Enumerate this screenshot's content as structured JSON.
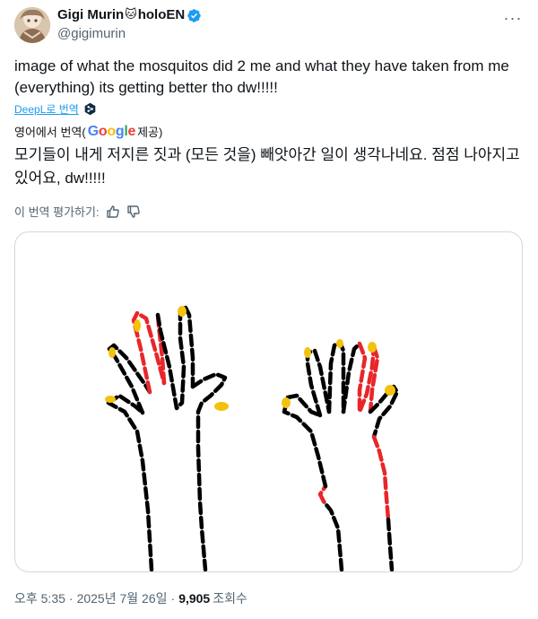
{
  "author": {
    "display_name": "Gigi Murin",
    "name_suffix": "holoEN",
    "emoji": "🐱",
    "handle": "@gigimurin",
    "verified": true
  },
  "post": {
    "text": "image of what the mosquitos did 2 me and what they have taken from me (everything) its getting better tho dw!!!!!",
    "translate_link": "DeepL로 번역",
    "translated_from_prefix": "영어에서 번역(",
    "translated_from_suffix": " 제공)",
    "translated_text": "모기들이 내게 저지른 짓과 (모든 것을) 빼앗아간 일이 생각나네요. 점점 나아지고 있어요, dw!!!!!",
    "rate_label": "이 번역 평가하기:"
  },
  "meta": {
    "time": "오후 5:35",
    "date": "2025년 7월 26일",
    "views": "9,905",
    "views_label": "조회수"
  },
  "colors": {
    "accent": "#1d9bf0",
    "muted": "#536471",
    "drawing_black": "#000000",
    "drawing_red": "#e8262a",
    "drawing_yellow": "#f4c20d"
  }
}
